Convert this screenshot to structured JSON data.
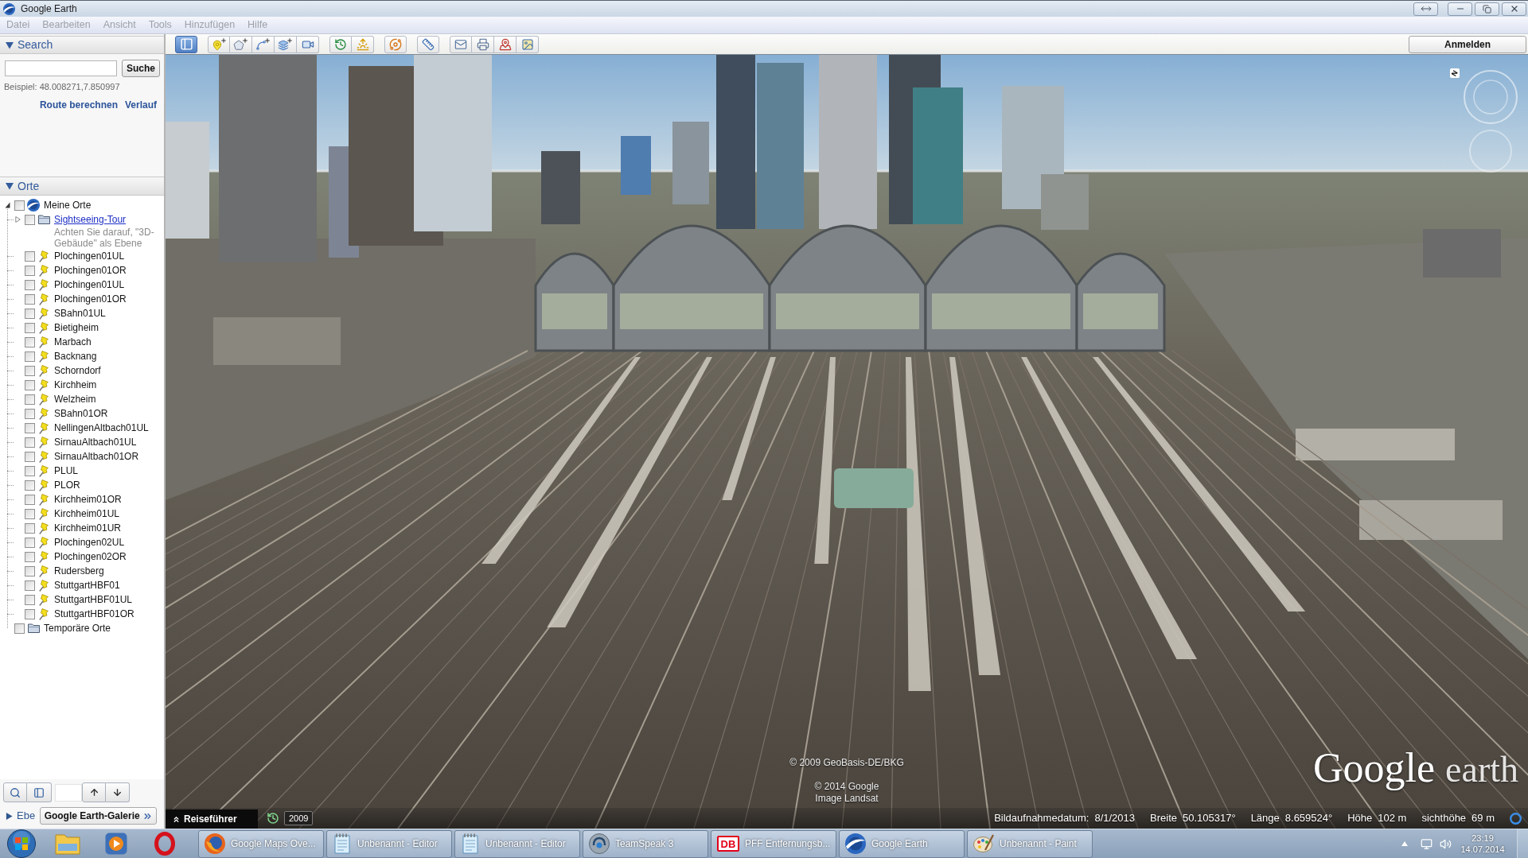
{
  "window": {
    "title": "Google Earth"
  },
  "menu": [
    {
      "label": "Datei",
      "disabled": true
    },
    {
      "label": "Bearbeiten",
      "disabled": true
    },
    {
      "label": "Ansicht",
      "disabled": true
    },
    {
      "label": "Tools",
      "disabled": true
    },
    {
      "label": "Hinzufügen",
      "disabled": true
    },
    {
      "label": "Hilfe",
      "disabled": true
    }
  ],
  "toolbar": {
    "groups": [
      {
        "buttons": [
          {
            "kind": "sidebar",
            "selected": true
          }
        ]
      },
      {
        "buttons": [
          {
            "kind": "placemark",
            "selected": false
          },
          {
            "kind": "polygon",
            "selected": false
          },
          {
            "kind": "path",
            "selected": false
          },
          {
            "kind": "overlay",
            "selected": false
          },
          {
            "kind": "tour",
            "selected": false
          }
        ]
      },
      {
        "buttons": [
          {
            "kind": "history",
            "selected": false
          },
          {
            "kind": "sun",
            "selected": false
          }
        ]
      },
      {
        "buttons": [
          {
            "kind": "planet",
            "selected": false
          }
        ]
      },
      {
        "buttons": [
          {
            "kind": "ruler",
            "selected": false
          }
        ]
      },
      {
        "buttons": [
          {
            "kind": "email",
            "selected": false
          },
          {
            "kind": "print",
            "selected": false
          },
          {
            "kind": "maps",
            "selected": false
          },
          {
            "kind": "image",
            "selected": false
          }
        ]
      }
    ]
  },
  "account_button": "Anmelden",
  "search": {
    "title": "Search",
    "expanded": true,
    "button": "Suche",
    "example": "Beispiel: 48.008271,7.850997",
    "links": [
      "Route berechnen",
      "Verlauf"
    ]
  },
  "places": {
    "title": "Orte",
    "expanded": true,
    "tree": [
      {
        "label": "Meine Orte",
        "kind": "globe",
        "checked": false,
        "expanded": true,
        "children": [
          {
            "label": "Sightseeing-Tour",
            "kind": "folder",
            "link": true,
            "checked": false,
            "expanded": false,
            "description": "Achten Sie darauf, \"3D-Gebäude\" als Ebene"
          },
          {
            "label": "Plochingen01UL",
            "kind": "placemark",
            "checked": false
          },
          {
            "label": "Plochingen01OR",
            "kind": "placemark",
            "checked": false
          },
          {
            "label": "Plochingen01UL",
            "kind": "placemark",
            "checked": false
          },
          {
            "label": "Plochingen01OR",
            "kind": "placemark",
            "checked": false
          },
          {
            "label": "SBahn01UL",
            "kind": "placemark",
            "checked": false
          },
          {
            "label": "Bietigheim",
            "kind": "placemark",
            "checked": false
          },
          {
            "label": "Marbach",
            "kind": "placemark",
            "checked": false
          },
          {
            "label": "Backnang",
            "kind": "placemark",
            "checked": false
          },
          {
            "label": "Schorndorf",
            "kind": "placemark",
            "checked": false
          },
          {
            "label": "Kirchheim",
            "kind": "placemark",
            "checked": false
          },
          {
            "label": "Welzheim",
            "kind": "placemark",
            "checked": false
          },
          {
            "label": "SBahn01OR",
            "kind": "placemark",
            "checked": false
          },
          {
            "label": "NellingenAltbach01UL",
            "kind": "placemark",
            "checked": false
          },
          {
            "label": "SirnauAltbach01UL",
            "kind": "placemark",
            "checked": false
          },
          {
            "label": "SirnauAltbach01OR",
            "kind": "placemark",
            "checked": false
          },
          {
            "label": "PLUL",
            "kind": "placemark",
            "checked": false
          },
          {
            "label": "PLOR",
            "kind": "placemark",
            "checked": false
          },
          {
            "label": "Kirchheim01OR",
            "kind": "placemark",
            "checked": false
          },
          {
            "label": "Kirchheim01UL",
            "kind": "placemark",
            "checked": false
          },
          {
            "label": "Kirchheim01UR",
            "kind": "placemark",
            "checked": false
          },
          {
            "label": "Plochingen02UL",
            "kind": "placemark",
            "checked": false
          },
          {
            "label": "Plochingen02OR",
            "kind": "placemark",
            "checked": false
          },
          {
            "label": "Rudersberg",
            "kind": "placemark",
            "checked": false
          },
          {
            "label": "StuttgartHBF01",
            "kind": "placemark",
            "checked": false
          },
          {
            "label": "StuttgartHBF01UL",
            "kind": "placemark",
            "checked": false
          },
          {
            "label": "StuttgartHBF01OR",
            "kind": "placemark",
            "checked": false
          }
        ]
      },
      {
        "label": "Temporäre Orte",
        "kind": "folder",
        "checked": false
      }
    ]
  },
  "layers": {
    "title": "Ebe",
    "expanded": false
  },
  "gallery_button": "Google Earth-Galerie",
  "map": {
    "compass_label": "N",
    "tour_guide": {
      "label": "Reiseführer",
      "expanded": false
    },
    "imagery_year": "2009",
    "attribution": [
      {
        "lines": [
          "© 2009 GeoBasis-DE/BKG"
        ]
      },
      {
        "lines": [
          "© 2014 Google",
          "Image Landsat"
        ]
      }
    ],
    "logo": {
      "name": "Google",
      "product": "earth"
    },
    "status": [
      {
        "label": "Bildaufnahmedatum:",
        "value": "8/1/2013"
      },
      {
        "label": "Breite",
        "value": "50.105317°"
      },
      {
        "label": "Länge",
        "value": "8.659524°"
      },
      {
        "label": "Höhe",
        "value": "102 m"
      },
      {
        "label": "sichthöhe",
        "value": "69 m"
      }
    ]
  },
  "taskbar": {
    "pinned": [
      {
        "kind": "start"
      },
      {
        "kind": "explorer"
      },
      {
        "kind": "media-player"
      },
      {
        "kind": "opera"
      }
    ],
    "tasks": [
      {
        "kind": "firefox",
        "label": "Google Maps Ove..."
      },
      {
        "kind": "notepad",
        "label": "Unbenannt - Editor"
      },
      {
        "kind": "notepad",
        "label": "Unbenannt - Editor"
      },
      {
        "kind": "teamspeak",
        "label": "TeamSpeak 3"
      },
      {
        "kind": "db",
        "badge": "DB",
        "label": "PFF Entfernungsb..."
      },
      {
        "kind": "google-earth",
        "label": "Google Earth"
      },
      {
        "kind": "paint",
        "label": "Unbenannt - Paint"
      }
    ],
    "clock": {
      "time": "23:19",
      "date": "14.07.2014"
    }
  }
}
